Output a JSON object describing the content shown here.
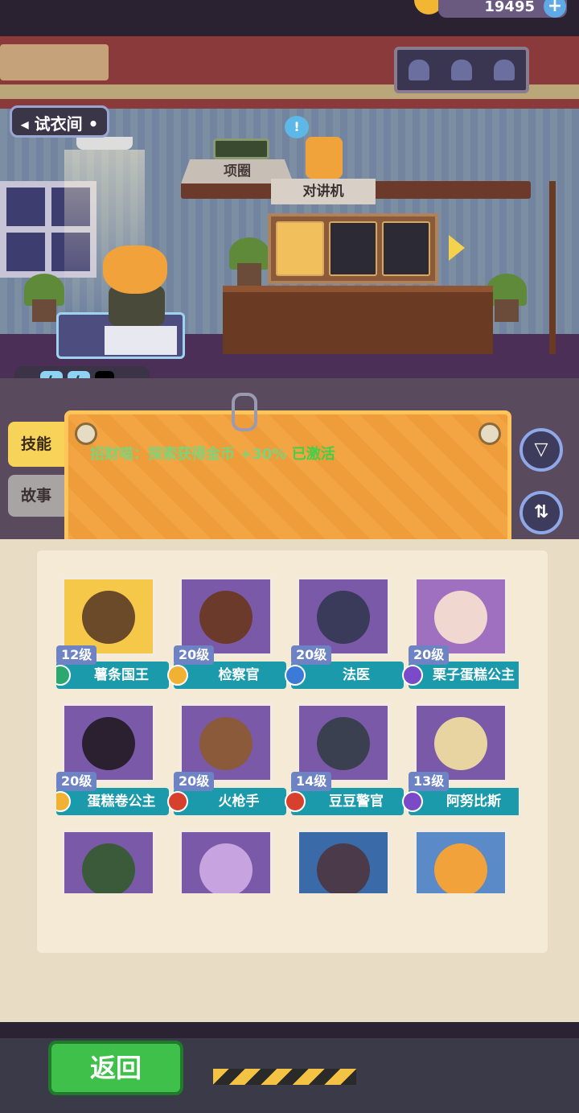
{
  "header": {
    "coins": "19495",
    "plus_label": "+"
  },
  "room": {
    "fitting_room_label": "◂ 试衣间 •",
    "collar_label": "项圈",
    "walkie_label": "对讲机",
    "bubble_label": "!",
    "energy": {
      "bolt_label": "ϟ"
    }
  },
  "tabs": {
    "skill": "技能",
    "story": "故事"
  },
  "skill": {
    "text": "招财喵：探索获得金币 +30% ",
    "status": "已激活"
  },
  "buttons": {
    "filter_label": "▽",
    "sort_label": "⇅",
    "back": "返回"
  },
  "characters": [
    {
      "level": "12级",
      "name": "薯条国王",
      "badge": "#2aa870"
    },
    {
      "level": "20级",
      "name": "检察官",
      "badge": "#f1b233"
    },
    {
      "level": "20级",
      "name": "法医",
      "badge": "#3b7ad6"
    },
    {
      "level": "20级",
      "name": "栗子蛋糕公主",
      "badge": "#7a4ac8"
    },
    {
      "level": "20级",
      "name": "蛋糕卷公主",
      "badge": "#f1b233"
    },
    {
      "level": "20级",
      "name": "火枪手",
      "badge": "#d8402e"
    },
    {
      "level": "14级",
      "name": "豆豆警官",
      "badge": "#d8402e"
    },
    {
      "level": "13级",
      "name": "阿努比斯",
      "badge": "#7a4ac8"
    }
  ],
  "colors": {
    "accent": "#1a9aaa",
    "board": "#f3a543",
    "activated": "#3fd14a"
  }
}
